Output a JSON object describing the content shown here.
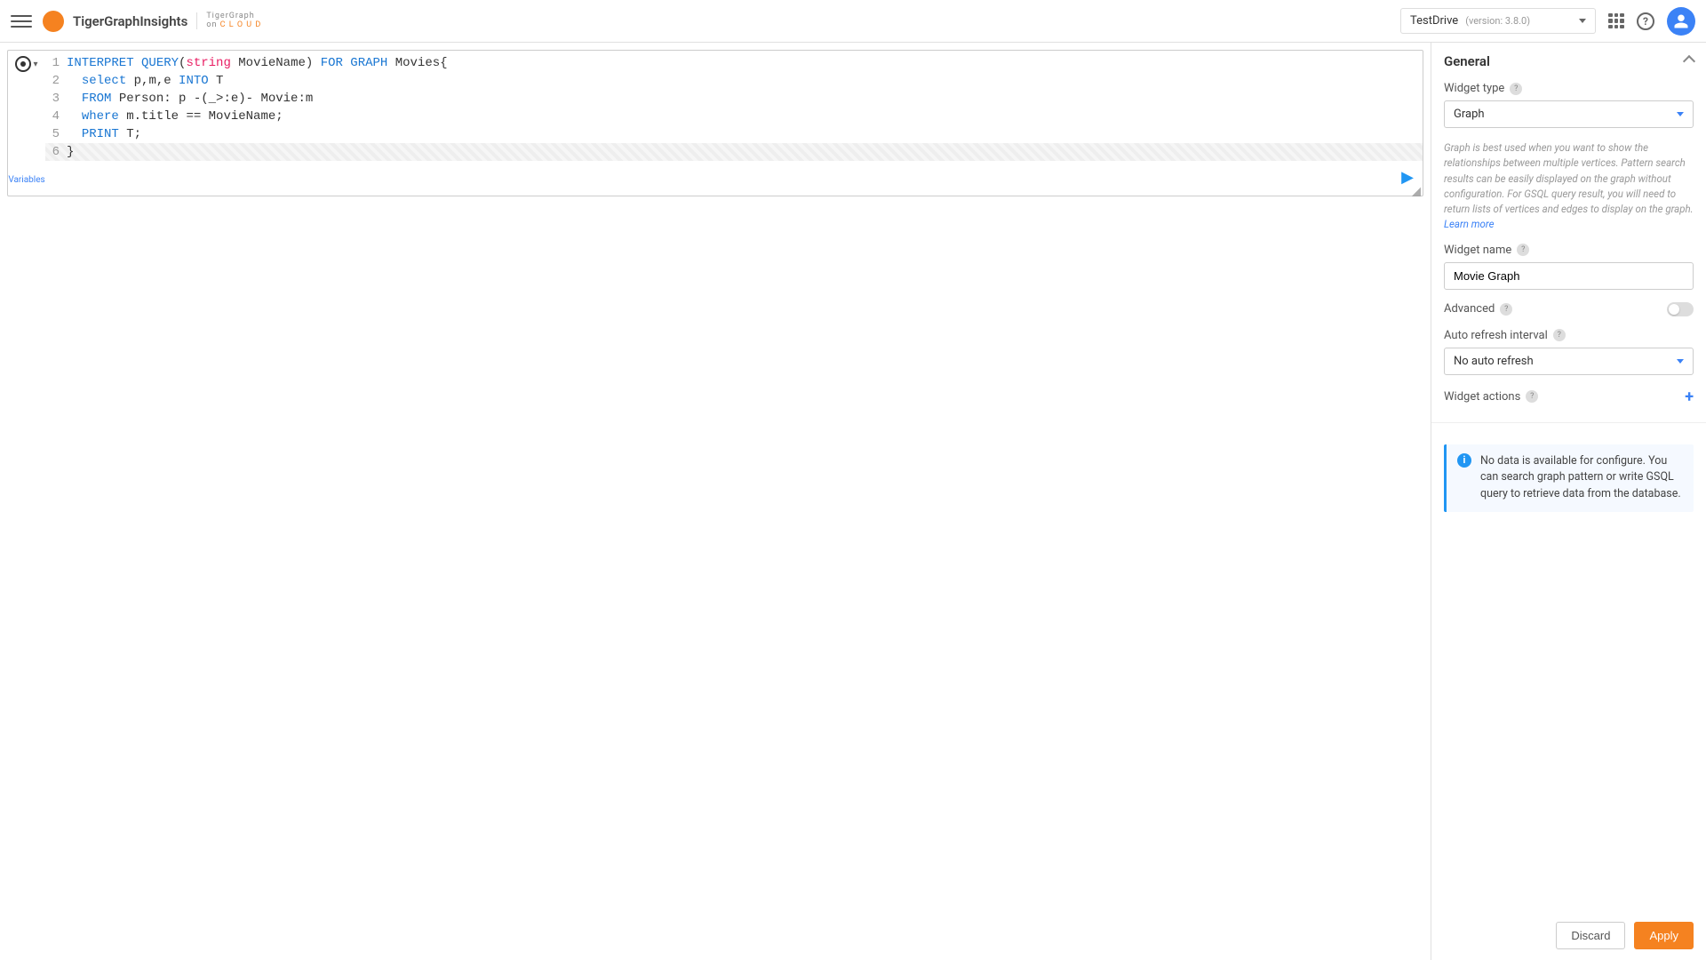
{
  "header": {
    "logo": "TigerGraphInsights",
    "logo_cloud_top": "TigerGraph",
    "logo_cloud_bottom_on": "on",
    "logo_cloud_bottom_cloud": "C L O U D",
    "project_name": "TestDrive",
    "version_label": "(version: 3.8.0)"
  },
  "editor": {
    "variables_label": "Variables",
    "lines": [
      {
        "n": "1",
        "tokens": [
          {
            "t": "INTERPRET QUERY",
            "c": "kw"
          },
          {
            "t": "(",
            "c": ""
          },
          {
            "t": "string",
            "c": "kw2"
          },
          {
            "t": " MovieName) ",
            "c": ""
          },
          {
            "t": "FOR GRAPH",
            "c": "kw"
          },
          {
            "t": " Movies{",
            "c": ""
          }
        ]
      },
      {
        "n": "2",
        "tokens": [
          {
            "t": "  ",
            "c": ""
          },
          {
            "t": "select",
            "c": "kw"
          },
          {
            "t": " p,m,e ",
            "c": ""
          },
          {
            "t": "INTO",
            "c": "kw"
          },
          {
            "t": " T",
            "c": ""
          }
        ]
      },
      {
        "n": "3",
        "tokens": [
          {
            "t": "  ",
            "c": ""
          },
          {
            "t": "FROM",
            "c": "kw"
          },
          {
            "t": " Person: p -(_>:e)- Movie:m",
            "c": ""
          }
        ]
      },
      {
        "n": "4",
        "tokens": [
          {
            "t": "  ",
            "c": ""
          },
          {
            "t": "where",
            "c": "kw"
          },
          {
            "t": " m.title == MovieName;",
            "c": ""
          }
        ]
      },
      {
        "n": "5",
        "tokens": [
          {
            "t": "  ",
            "c": ""
          },
          {
            "t": "PRINT",
            "c": "kw"
          },
          {
            "t": " T;",
            "c": ""
          }
        ]
      },
      {
        "n": "6",
        "tokens": [
          {
            "t": "}",
            "c": ""
          }
        ],
        "hl": true
      }
    ]
  },
  "panel": {
    "section_title": "General",
    "widget_type_label": "Widget type",
    "widget_type_value": "Graph",
    "widget_type_help": "Graph is best used when you want to show the relationships between multiple vertices.\nPattern search results can be easily displayed on the graph without configuration.\nFor GSQL query result, you will need to return lists of vertices and edges to display on the graph.",
    "learn_more": "Learn more",
    "widget_name_label": "Widget name",
    "widget_name_value": "Movie Graph",
    "advanced_label": "Advanced",
    "auto_refresh_label": "Auto refresh interval",
    "auto_refresh_value": "No auto refresh",
    "widget_actions_label": "Widget actions",
    "info_text": "No data is available for configure. You can search graph pattern or write GSQL query to retrieve data from the database.",
    "discard": "Discard",
    "apply": "Apply"
  }
}
